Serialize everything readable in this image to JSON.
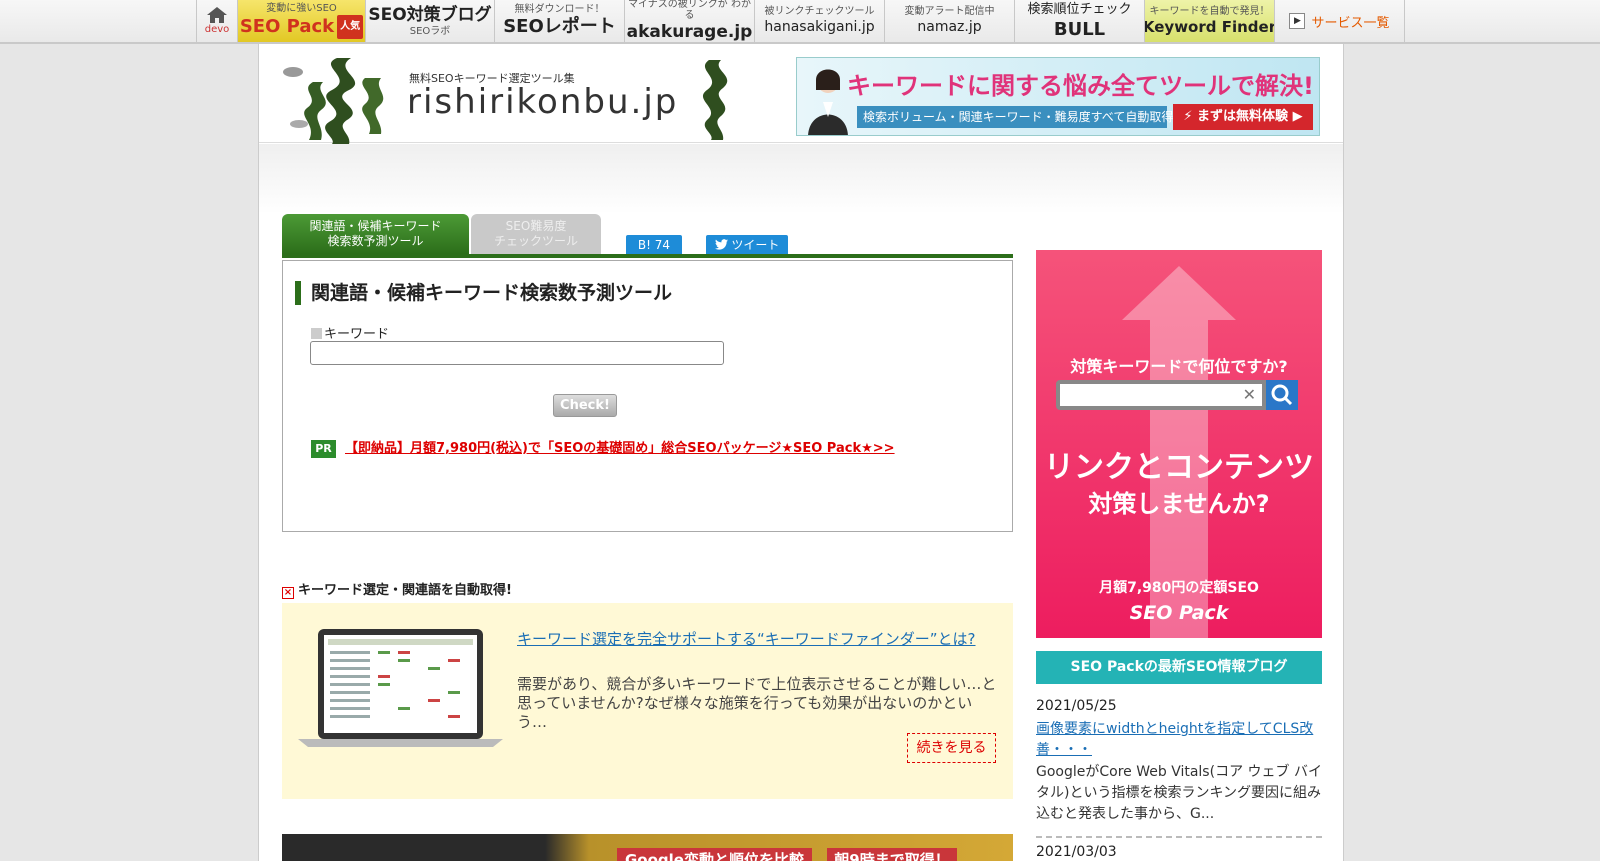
{
  "topnav": {
    "home_label": "devo",
    "items": [
      {
        "small": "変動に強いSEO",
        "large": "SEO Pack",
        "badge": "人気"
      },
      {
        "large": "SEO対策ブログ",
        "small": "SEOラボ"
      },
      {
        "small": "無料ダウンロード！",
        "large": "SEOレポート"
      },
      {
        "small": "マイナスの被リンクが わかる",
        "large": "akakurage.jp"
      },
      {
        "small": "被リンクチェックツール",
        "large": "hanasakigani.jp"
      },
      {
        "small": "変動アラート配信中",
        "large": "namaz.jp"
      },
      {
        "small": "検索順位チェック",
        "large": "BULL"
      },
      {
        "small": "キーワードを自動で発見！",
        "large": "Keyword Finder"
      }
    ],
    "services_label": "サービス一覧"
  },
  "header": {
    "logo_sub": "無料SEOキーワード選定ツール集",
    "logo_text": "rishirikonbu.jp",
    "banner_headline": "キーワードに関する悩み全てツールで解決!",
    "banner_sub": "検索ボリューム・関連キーワード・難易度すべて自動取得!",
    "banner_cta": "まずは無料体験"
  },
  "tabs": {
    "active_line1": "関連語・候補キーワード",
    "active_line2": "検索数予測ツール",
    "inactive_line1": "SEO難易度",
    "inactive_line2": "チェックツール"
  },
  "share": {
    "hatena": "B! 74",
    "tweet": "ツイート"
  },
  "tool": {
    "title": "関連語・候補キーワード検索数予測ツール",
    "keyword_label": "キーワード",
    "keyword_value": "",
    "check_button": "Check!",
    "pr_badge": "PR",
    "pr_link": "【即納品】月額7,980円(税込)で「SEOの基礎固め」総合SEOパッケージ★SEO Pack★>>"
  },
  "keyword_finder": {
    "heading": "キーワード選定・関連語を自動取得!",
    "link": "キーワード選定を完全サポートする“キーワードファインダー”とは?",
    "text": "需要があり、競合が多いキーワードで上位表示させることが難しい…と思っていませんか?なぜ様々な施策を行っても効果が出ないのかという…",
    "more": "続きを見る"
  },
  "bottom_banner": {
    "b1": "Google変動と順位を比較",
    "b2": "朝9時まで取得！"
  },
  "sidebar": {
    "ad_question": "対策キーワードで何位ですか?",
    "ad_big1": "リンクとコンテンツ",
    "ad_big2": "対策しませんか?",
    "ad_price": "月額7,980円の定額SEO",
    "ad_brand": "SEO Pack",
    "blog_header": "SEO Packの最新SEO情報ブログ",
    "posts": [
      {
        "date": "2021/05/25",
        "title": "画像要素にwidthとheightを指定してCLS改善・・・",
        "desc": "GoogleがCore Web Vitals(コア ウェブ バイタル)という指標を検索ランキング要因に組み込むと発表した事から、G..."
      },
      {
        "date": "2021/03/03"
      }
    ]
  },
  "colors": {
    "brand_green": "#2c6e1a",
    "accent_pink": "#ed1d5f",
    "teal": "#24b3b5",
    "link_blue": "#1a6eb5",
    "pr_red": "#dd0000"
  }
}
